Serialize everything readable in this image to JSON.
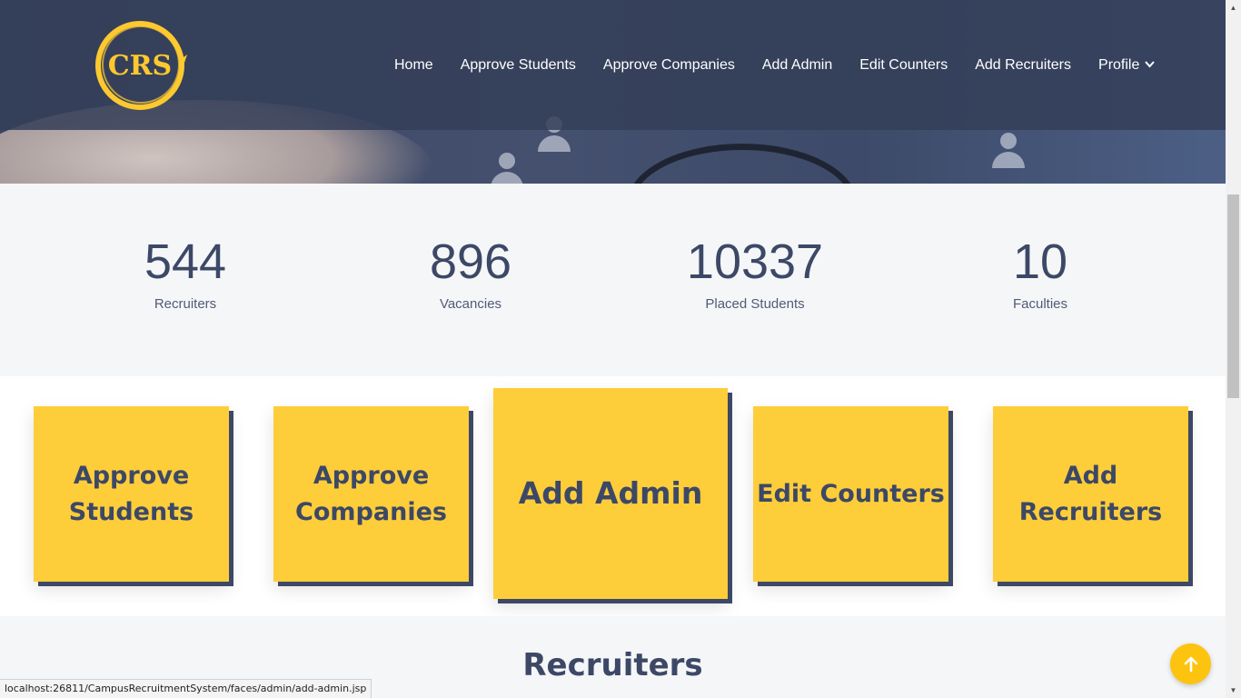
{
  "header": {
    "logo_text": "CRS",
    "nav": [
      {
        "label": "Home"
      },
      {
        "label": "Approve Students"
      },
      {
        "label": "Approve Companies"
      },
      {
        "label": "Add Admin"
      },
      {
        "label": "Edit Counters"
      },
      {
        "label": "Add Recruiters"
      },
      {
        "label": "Profile"
      }
    ],
    "profile_icon": "chevron-down-icon"
  },
  "counters": [
    {
      "value": "544",
      "label": "Recruiters"
    },
    {
      "value": "896",
      "label": "Vacancies"
    },
    {
      "value": "10337",
      "label": "Placed Students"
    },
    {
      "value": "10",
      "label": "Faculties"
    }
  ],
  "cards": [
    {
      "line1": "Approve",
      "line2": "Students"
    },
    {
      "line1": "Approve",
      "line2": "Companies"
    },
    {
      "line1": "Add Admin"
    },
    {
      "line1": "Edit Counters"
    },
    {
      "line1": "Add",
      "line2": "Recruiters"
    }
  ],
  "section": {
    "title": "Recruiters"
  },
  "back_to_top_icon": "arrow-up-icon",
  "status_bar": {
    "url": "localhost:26811/CampusRecruitmentSystem/faces/admin/add-admin.jsp"
  },
  "colors": {
    "accent": "#fecd3a",
    "navy": "#3c4866",
    "header": "#3b4663"
  }
}
